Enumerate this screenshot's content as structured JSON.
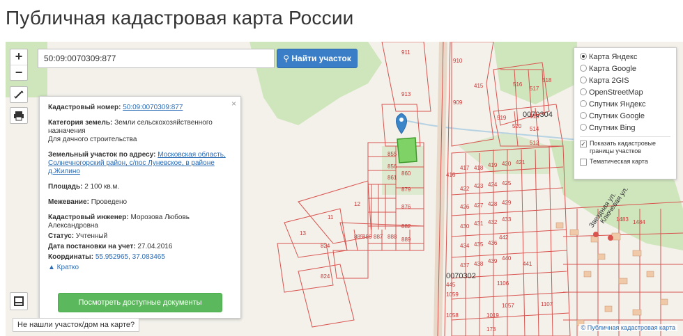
{
  "page_title": "Публичная кадастровая карта России",
  "search": {
    "value": "50:09:0070309:877",
    "button_label": "Найти участок"
  },
  "zoom": {
    "in": "+",
    "out": "−"
  },
  "info": {
    "cad_label": "Кадастровый номер:",
    "cad_value": "50:09:0070309:877",
    "cat_label": "Категория земель:",
    "cat_value": "Земли сельскохозяйственного назначения",
    "use_value": "Для дачного строительства",
    "addr_label": "Земельный участок по адресу:",
    "addr_value": "Московская область, Солнечногорский район, с/пос Луневское, в районе д.Жилино",
    "area_label": "Площадь:",
    "area_value": "2 100 кв.м.",
    "survey_label": "Межевание:",
    "survey_value": "Проведено",
    "engineer_label": "Кадастровый инженер:",
    "engineer_value": "Морозова Любовь Александровна",
    "status_label": "Статус:",
    "status_value": "Учтенный",
    "date_label": "Дата постановки на учет:",
    "date_value": "27.04.2016",
    "coords_label": "Координаты:",
    "coords_value": "55.952965, 37.083465",
    "brief": "▲ Кратко",
    "close": "×",
    "docs_button": "Посмотреть доступные документы"
  },
  "layers": {
    "options": [
      {
        "label": "Карта Яндекс",
        "selected": true
      },
      {
        "label": "Карта Google",
        "selected": false
      },
      {
        "label": "Карта 2GIS",
        "selected": false
      },
      {
        "label": "OpenStreetMap",
        "selected": false
      },
      {
        "label": "Спутник Яндекс",
        "selected": false
      },
      {
        "label": "Спутник Google",
        "selected": false
      },
      {
        "label": "Спутник Bing",
        "selected": false
      }
    ],
    "show_borders": "Показать кадастровые границы участков",
    "thematic": "Тематическая карта",
    "check_mark": "✓"
  },
  "not_found": "Не нашли участок/дом на карте?",
  "attribution": "© Публичная кадастровая карта",
  "map_labels": [
    "911",
    "913",
    "910",
    "909",
    "415",
    "516",
    "517",
    "518",
    "519",
    "520",
    "514",
    "512",
    "513",
    "0070304",
    "855",
    "856",
    "860",
    "861",
    "879",
    "876",
    "882",
    "889",
    "888",
    "887",
    "886",
    "885",
    "12",
    "11",
    "13",
    "824",
    "824",
    "416",
    "417",
    "418",
    "419",
    "420",
    "421",
    "422",
    "423",
    "424",
    "425",
    "426",
    "427",
    "428",
    "429",
    "430",
    "431",
    "432",
    "433",
    "434",
    "435",
    "436",
    "437",
    "438",
    "439",
    "440",
    "441",
    "442",
    "0070302",
    "445",
    "1059",
    "1058",
    "1057",
    "1019",
    "173",
    "1106",
    "1107",
    "Звездная ул.",
    "Ключевая ул.",
    "1483",
    "1484",
    "1485",
    "148"
  ],
  "colors": {
    "parcel": "#d9534f",
    "forest": "#c9e3b5",
    "selected": "#6ecf5a",
    "water": "#b8d4e6",
    "pin": "#3a86c8"
  }
}
